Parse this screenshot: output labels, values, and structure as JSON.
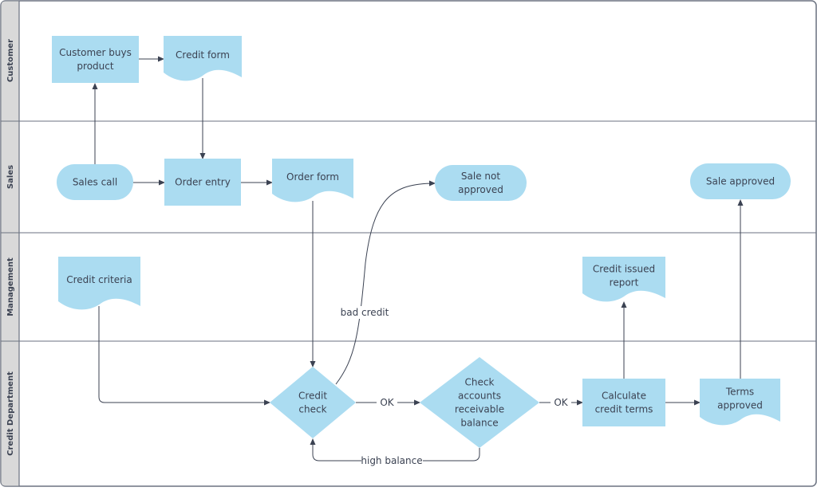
{
  "lanes": [
    {
      "label": "Customer"
    },
    {
      "label": "Sales"
    },
    {
      "label": "Management"
    },
    {
      "label": "Credit Department"
    }
  ],
  "nodes": {
    "customer_buys": {
      "lines": [
        "Customer buys",
        "product"
      ],
      "shape": "process"
    },
    "credit_form": {
      "lines": [
        "Credit form"
      ],
      "shape": "document"
    },
    "sales_call": {
      "lines": [
        "Sales call"
      ],
      "shape": "terminator"
    },
    "order_entry": {
      "lines": [
        "Order entry"
      ],
      "shape": "process"
    },
    "order_form": {
      "lines": [
        "Order form"
      ],
      "shape": "document"
    },
    "sale_not_approved": {
      "lines": [
        "Sale not",
        "approved"
      ],
      "shape": "terminator"
    },
    "sale_approved": {
      "lines": [
        "Sale approved"
      ],
      "shape": "terminator"
    },
    "credit_criteria": {
      "lines": [
        "Credit criteria"
      ],
      "shape": "document"
    },
    "credit_issued_report": {
      "lines": [
        "Credit issued",
        "report"
      ],
      "shape": "document"
    },
    "credit_check": {
      "lines": [
        "Credit",
        "check"
      ],
      "shape": "decision"
    },
    "check_ar": {
      "lines": [
        "Check",
        "accounts",
        "receivable",
        "balance"
      ],
      "shape": "decision"
    },
    "calculate_terms": {
      "lines": [
        "Calculate",
        "credit terms"
      ],
      "shape": "process"
    },
    "terms_approved": {
      "lines": [
        "Terms",
        "approved"
      ],
      "shape": "document"
    }
  },
  "edge_labels": {
    "bad_credit": "bad credit",
    "ok1": "OK",
    "ok2": "OK",
    "high_balance": "high balance"
  },
  "colors": {
    "node_fill": "#abdcf1",
    "line": "#3b4252",
    "lane_header": "#d9d9d9",
    "border": "#6b7280"
  }
}
